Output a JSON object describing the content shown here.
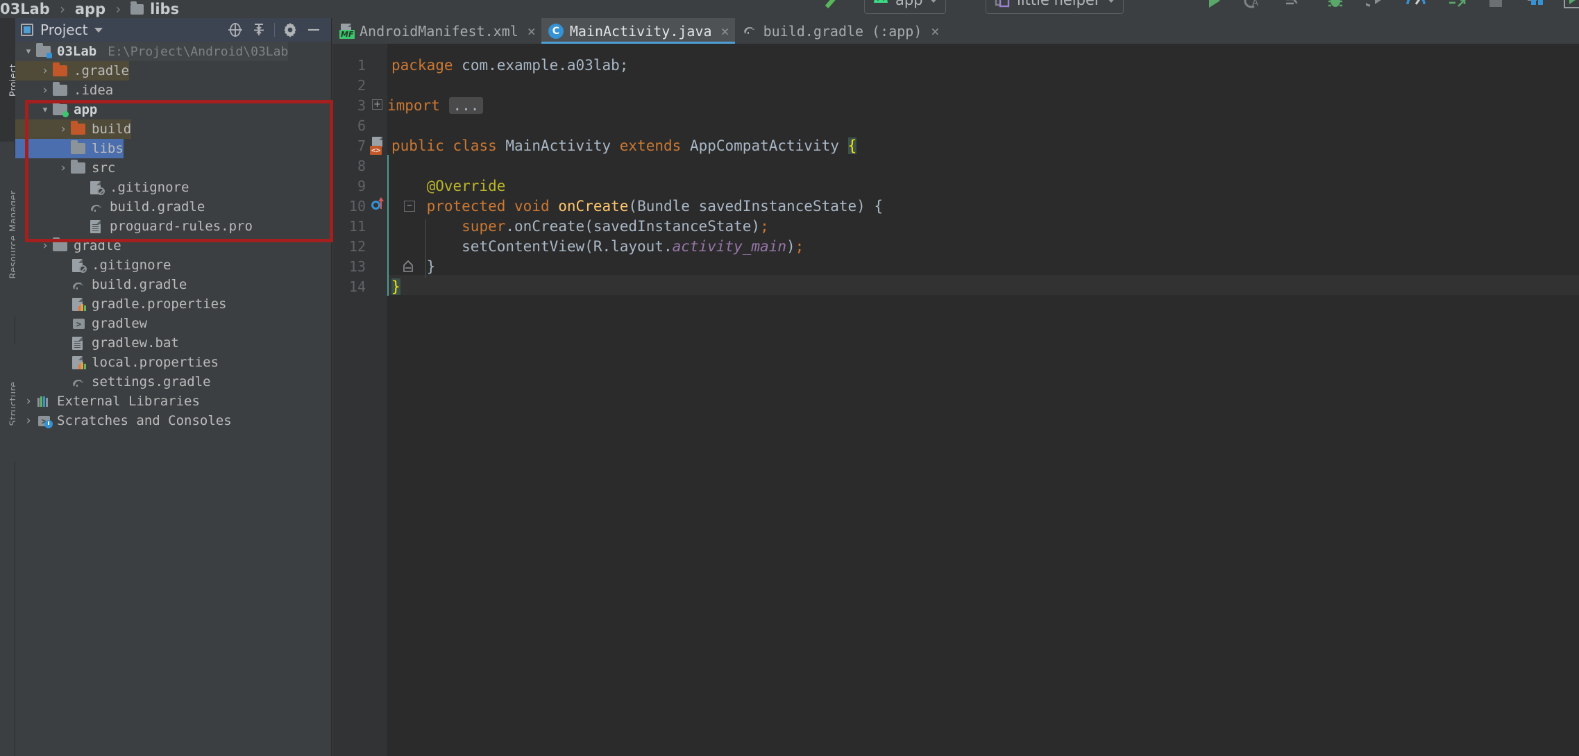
{
  "app": {
    "theme_bg": "#3c3f41",
    "editor_bg": "#2b2b2b",
    "accent": "#4e9fd4",
    "highlight_box_color": "#a51f1f",
    "selection_color": "#4b6eaf",
    "excluded_color": "#4f4b38"
  },
  "toolbar": {
    "module_selector": "app",
    "run_config": "little helper",
    "icons": [
      "hammer-build-icon",
      "android-icon",
      "chevron-down-icon",
      "device-icon",
      "run-icon",
      "code-analyze-icon",
      "logcat-icon",
      "debug-icon",
      "run-coverage-icon",
      "profiler-icon",
      "apply-changes-icon",
      "stop-icon",
      "avd-manager-icon",
      "sdk-manager-icon"
    ]
  },
  "breadcrumb": {
    "segments": [
      {
        "label": "03Lab",
        "icon": ""
      },
      {
        "label": "app",
        "icon": ""
      },
      {
        "label": "libs",
        "icon": "folder-icon"
      }
    ],
    "separator": "›"
  },
  "left_rail": {
    "items": [
      {
        "label": "Project",
        "active": true
      },
      {
        "label": "Resource Manager",
        "active": false
      },
      {
        "label": "Structure",
        "active": false
      }
    ]
  },
  "project_panel": {
    "title": "Project",
    "dropdown_icon": "chevron-down-icon",
    "panel_icon": "project-view-icon",
    "actions": [
      {
        "name": "select-opened-file-icon",
        "glyph": "target"
      },
      {
        "name": "collapse-all-icon",
        "glyph": "collapse"
      },
      {
        "name": "settings-gear-icon",
        "glyph": "gear"
      },
      {
        "name": "hide-panel-icon",
        "glyph": "minus"
      }
    ],
    "tree": [
      {
        "label": "03Lab",
        "path": "E:\\Project\\Android\\03Lab",
        "icon": "module-folder-icon",
        "arrow": "down",
        "indent": 0,
        "bold": true,
        "state": "root"
      },
      {
        "label": ".gradle",
        "icon": "folder-orange-icon",
        "arrow": "right",
        "indent": 1,
        "state": "excluded"
      },
      {
        "label": ".idea",
        "icon": "folder-grey-icon",
        "arrow": "right",
        "indent": 1,
        "state": "normal"
      },
      {
        "label": "app",
        "icon": "module-folder-green-icon",
        "arrow": "down",
        "indent": 1,
        "bold": true,
        "state": "normal"
      },
      {
        "label": "build",
        "icon": "folder-orange-icon",
        "arrow": "right",
        "indent": 2,
        "state": "excluded"
      },
      {
        "label": "libs",
        "icon": "folder-grey-icon",
        "arrow": "none",
        "indent": 2,
        "state": "selected"
      },
      {
        "label": "src",
        "icon": "folder-grey-icon",
        "arrow": "right",
        "indent": 2,
        "state": "normal"
      },
      {
        "label": ".gitignore",
        "icon": "gitignore-file-icon",
        "arrow": "none",
        "indent": 3,
        "state": "normal"
      },
      {
        "label": "build.gradle",
        "icon": "gradle-file-icon",
        "arrow": "none",
        "indent": 3,
        "state": "normal"
      },
      {
        "label": "proguard-rules.pro",
        "icon": "text-file-icon",
        "arrow": "none",
        "indent": 3,
        "state": "normal"
      },
      {
        "label": "gradle",
        "icon": "folder-grey-icon",
        "arrow": "right",
        "indent": 1,
        "state": "normal"
      },
      {
        "label": ".gitignore",
        "icon": "gitignore-file-icon",
        "arrow": "none",
        "indent": 2,
        "state": "normal"
      },
      {
        "label": "build.gradle",
        "icon": "gradle-file-icon",
        "arrow": "none",
        "indent": 2,
        "state": "normal"
      },
      {
        "label": "gradle.properties",
        "icon": "properties-file-icon",
        "arrow": "none",
        "indent": 2,
        "state": "normal"
      },
      {
        "label": "gradlew",
        "icon": "shell-script-icon",
        "arrow": "none",
        "indent": 2,
        "state": "normal"
      },
      {
        "label": "gradlew.bat",
        "icon": "text-file-icon",
        "arrow": "none",
        "indent": 2,
        "state": "normal"
      },
      {
        "label": "local.properties",
        "icon": "properties-file-icon",
        "arrow": "none",
        "indent": 2,
        "state": "normal"
      },
      {
        "label": "settings.gradle",
        "icon": "gradle-file-icon",
        "arrow": "none",
        "indent": 2,
        "state": "normal"
      },
      {
        "label": "External Libraries",
        "icon": "libraries-icon",
        "arrow": "right",
        "indent": 0,
        "state": "normal"
      },
      {
        "label": "Scratches and Consoles",
        "icon": "scratches-icon",
        "arrow": "right",
        "indent": 0,
        "state": "normal"
      }
    ]
  },
  "editor": {
    "tabs": [
      {
        "label": "AndroidManifest.xml",
        "icon": "manifest-file-icon",
        "active": false,
        "close": "×"
      },
      {
        "label": "MainActivity.java",
        "icon": "java-class-icon",
        "active": true,
        "close": "×"
      },
      {
        "label": "build.gradle (:app)",
        "icon": "gradle-file-icon",
        "active": false,
        "close": "×"
      }
    ],
    "line_numbers": [
      "1",
      "2",
      "3",
      "6",
      "7",
      "8",
      "9",
      "10",
      "11",
      "12",
      "13",
      "14"
    ],
    "code_lines": [
      {
        "num": "1",
        "text": "package com.example.a03lab;"
      },
      {
        "num": "2",
        "text": ""
      },
      {
        "num": "3",
        "text": "import ..."
      },
      {
        "num": "6",
        "text": ""
      },
      {
        "num": "7",
        "text": "public class MainActivity extends AppCompatActivity {"
      },
      {
        "num": "8",
        "text": ""
      },
      {
        "num": "9",
        "text": "    @Override"
      },
      {
        "num": "10",
        "text": "    protected void onCreate(Bundle savedInstanceState) {"
      },
      {
        "num": "11",
        "text": "        super.onCreate(savedInstanceState);"
      },
      {
        "num": "12",
        "text": "        setContentView(R.layout.activity_main);"
      },
      {
        "num": "13",
        "text": "    }"
      },
      {
        "num": "14",
        "text": "}"
      }
    ],
    "gutter_markers": [
      {
        "line": "3",
        "name": "fold-expand-icon"
      },
      {
        "line": "7",
        "name": "class-manifest-marker-icon"
      },
      {
        "line": "10",
        "name": "override-method-marker-icon"
      },
      {
        "line": "10",
        "name": "fold-collapse-icon"
      },
      {
        "line": "13",
        "name": "fold-end-icon"
      }
    ],
    "tokens": {
      "package_kw": "package",
      "import_kw": "import",
      "ellipsis": "...",
      "public_kw": "public",
      "class_kw": "class",
      "extends_kw": "extends",
      "protected_kw": "protected",
      "void_kw": "void",
      "super_kw": "super",
      "class_name": "MainActivity",
      "super_class": "AppCompatActivity",
      "method_name": "onCreate",
      "annotation": "@Override",
      "field_ref": "activity_main",
      "package_path": "com.example.a03lab;"
    }
  }
}
